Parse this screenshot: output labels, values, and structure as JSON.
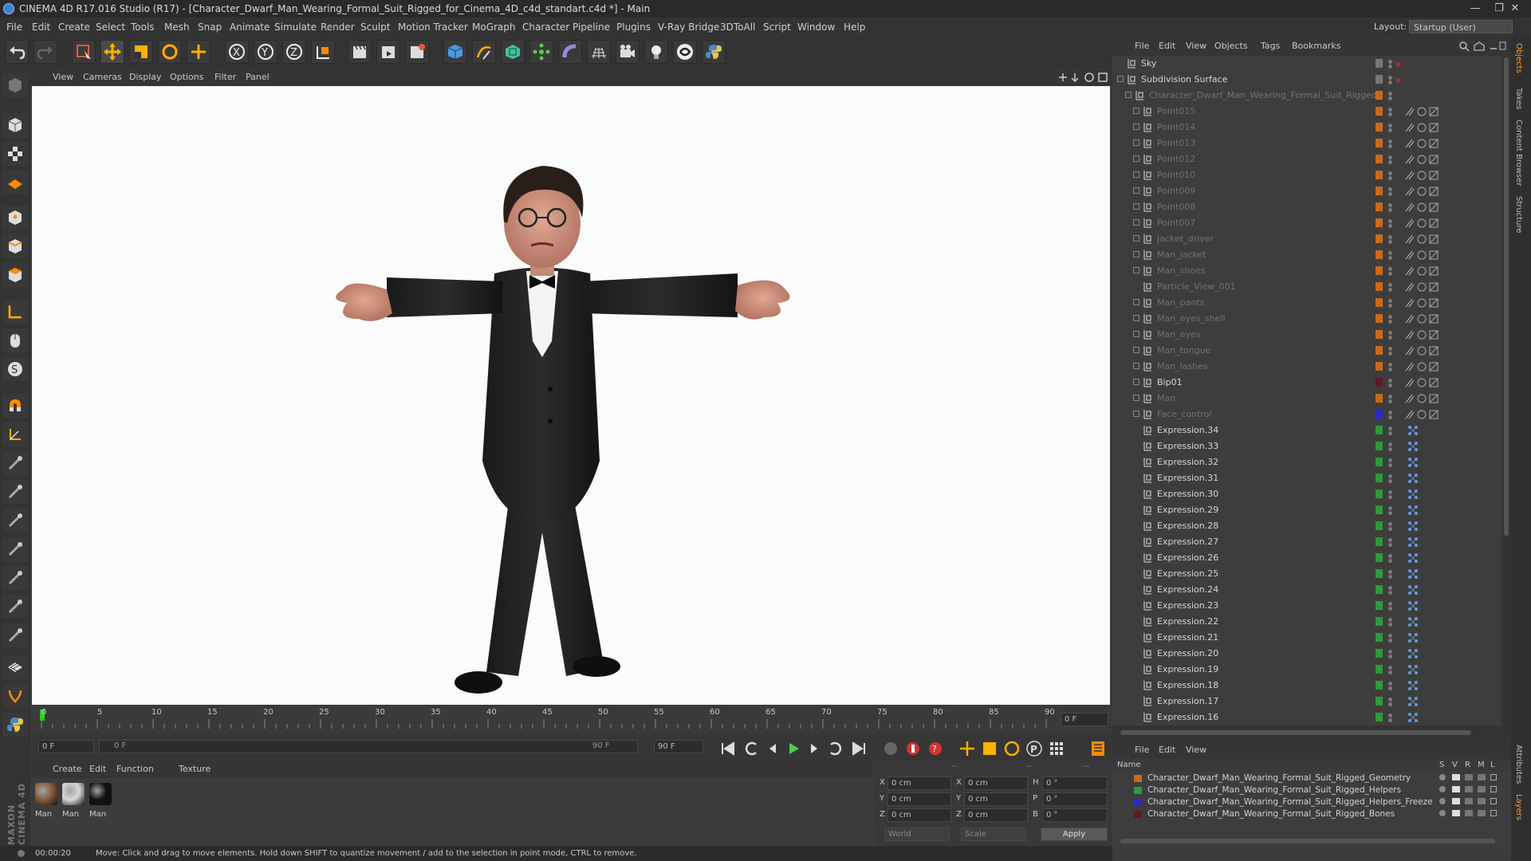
{
  "window": {
    "title": "CINEMA 4D R17.016 Studio (R17) - [Character_Dwarf_Man_Wearing_Formal_Suit_Rigged_for_Cinema_4D_c4d_standart.c4d *] - Main",
    "minimize": "—",
    "restore": "❐",
    "close": "✕"
  },
  "menu": {
    "items": [
      "File",
      "Edit",
      "Create",
      "Select",
      "Tools",
      "Mesh",
      "Snap",
      "Animate",
      "Simulate",
      "Render",
      "Sculpt",
      "Motion Tracker",
      "MoGraph",
      "Character",
      "Pipeline",
      "Plugins",
      "V-Ray Bridge",
      "3DToAll",
      "Script",
      "Window",
      "Help"
    ],
    "layout_label": "Layout:",
    "layout_value": "Startup (User)"
  },
  "viewport": {
    "menu": [
      "View",
      "Cameras",
      "Display",
      "Options",
      "Filter",
      "Panel"
    ]
  },
  "timeline": {
    "ticks": [
      "0",
      "5",
      "10",
      "15",
      "20",
      "25",
      "30",
      "35",
      "40",
      "45",
      "50",
      "55",
      "60",
      "65",
      "70",
      "75",
      "80",
      "85",
      "90"
    ],
    "current_frame": "0 F",
    "start_field": "0 F",
    "range_start": "0 F",
    "range_end": "90 F",
    "end_field": "90 F"
  },
  "materials": {
    "menu": [
      "Create",
      "Edit",
      "Function",
      "Texture"
    ],
    "items": [
      {
        "label": "Man",
        "color": "#8a5a3e"
      },
      {
        "label": "Man",
        "color": "#d8d8d8"
      },
      {
        "label": "Man",
        "color": "#111111"
      }
    ]
  },
  "coords": {
    "header": [
      "--",
      "--",
      "--"
    ],
    "rows": [
      {
        "a": "X",
        "av": "0 cm",
        "b": "X",
        "bv": "0 cm",
        "c": "H",
        "cv": "0 °"
      },
      {
        "a": "Y",
        "av": "0 cm",
        "b": "Y",
        "bv": "0 cm",
        "c": "P",
        "cv": "0 °"
      },
      {
        "a": "Z",
        "av": "0 cm",
        "b": "Z",
        "bv": "0 cm",
        "c": "B",
        "cv": "0 °"
      }
    ],
    "mode1": "World",
    "mode2": "Scale",
    "apply": "Apply"
  },
  "status": {
    "time": "00:00:20",
    "message": "Move: Click and drag to move elements. Hold down SHIFT to quantize movement / add to the selection in point mode, CTRL to remove."
  },
  "objects": {
    "menu": [
      "File",
      "Edit",
      "View",
      "Objects",
      "Tags",
      "Bookmarks"
    ],
    "rows": [
      {
        "name": "Sky",
        "indent": 0,
        "style": "bright",
        "expand": false
      },
      {
        "name": "Subdivision Surface",
        "indent": 0,
        "style": "bright",
        "expand": true
      },
      {
        "name": "Character_Dwarf_Man_Wearing_Formal_Suit_Rigged",
        "indent": 1,
        "style": "dim",
        "expand": true
      },
      {
        "name": "Point015",
        "indent": 2,
        "style": "dim",
        "expand": true
      },
      {
        "name": "Point014",
        "indent": 2,
        "style": "dim",
        "expand": true
      },
      {
        "name": "Point013",
        "indent": 2,
        "style": "dim",
        "expand": true
      },
      {
        "name": "Point012",
        "indent": 2,
        "style": "dim",
        "expand": true
      },
      {
        "name": "Point010",
        "indent": 2,
        "style": "dim",
        "expand": true
      },
      {
        "name": "Point009",
        "indent": 2,
        "style": "dim",
        "expand": true
      },
      {
        "name": "Point008",
        "indent": 2,
        "style": "dim",
        "expand": true
      },
      {
        "name": "Point007",
        "indent": 2,
        "style": "dim",
        "expand": true
      },
      {
        "name": "Jacket_driver",
        "indent": 2,
        "style": "dim",
        "expand": true
      },
      {
        "name": "Man_jacket",
        "indent": 2,
        "style": "dim",
        "expand": true
      },
      {
        "name": "Man_shoes",
        "indent": 2,
        "style": "dim",
        "expand": true
      },
      {
        "name": "Particle_View_001",
        "indent": 2,
        "style": "dim",
        "expand": false
      },
      {
        "name": "Man_pants",
        "indent": 2,
        "style": "dim",
        "expand": true
      },
      {
        "name": "Man_eyes_shell",
        "indent": 2,
        "style": "dim",
        "expand": true
      },
      {
        "name": "Man_eyes",
        "indent": 2,
        "style": "dim",
        "expand": true
      },
      {
        "name": "Man_tongue",
        "indent": 2,
        "style": "dim",
        "expand": true
      },
      {
        "name": "Man_lashes",
        "indent": 2,
        "style": "dim",
        "expand": true
      },
      {
        "name": "Bip01",
        "indent": 2,
        "style": "bright",
        "expand": true
      },
      {
        "name": "Man",
        "indent": 2,
        "style": "dim",
        "expand": true
      },
      {
        "name": "Face_control",
        "indent": 2,
        "style": "dim",
        "expand": true
      },
      {
        "name": "Expression.34",
        "indent": 2,
        "style": "bright",
        "expand": false
      },
      {
        "name": "Expression.33",
        "indent": 2,
        "style": "bright",
        "expand": false
      },
      {
        "name": "Expression.32",
        "indent": 2,
        "style": "bright",
        "expand": false
      },
      {
        "name": "Expression.31",
        "indent": 2,
        "style": "bright",
        "expand": false
      },
      {
        "name": "Expression.30",
        "indent": 2,
        "style": "bright",
        "expand": false
      },
      {
        "name": "Expression.29",
        "indent": 2,
        "style": "bright",
        "expand": false
      },
      {
        "name": "Expression.28",
        "indent": 2,
        "style": "bright",
        "expand": false
      },
      {
        "name": "Expression.27",
        "indent": 2,
        "style": "bright",
        "expand": false
      },
      {
        "name": "Expression.26",
        "indent": 2,
        "style": "bright",
        "expand": false
      },
      {
        "name": "Expression.25",
        "indent": 2,
        "style": "bright",
        "expand": false
      },
      {
        "name": "Expression.24",
        "indent": 2,
        "style": "bright",
        "expand": false
      },
      {
        "name": "Expression.23",
        "indent": 2,
        "style": "bright",
        "expand": false
      },
      {
        "name": "Expression.22",
        "indent": 2,
        "style": "bright",
        "expand": false
      },
      {
        "name": "Expression.21",
        "indent": 2,
        "style": "bright",
        "expand": false
      },
      {
        "name": "Expression.20",
        "indent": 2,
        "style": "bright",
        "expand": false
      },
      {
        "name": "Expression.19",
        "indent": 2,
        "style": "bright",
        "expand": false
      },
      {
        "name": "Expression.18",
        "indent": 2,
        "style": "bright",
        "expand": false
      },
      {
        "name": "Expression.17",
        "indent": 2,
        "style": "bright",
        "expand": false
      },
      {
        "name": "Expression.16",
        "indent": 2,
        "style": "bright",
        "expand": false
      }
    ]
  },
  "layers": {
    "menu": [
      "File",
      "Edit",
      "View"
    ],
    "header": {
      "name": "Name",
      "cols": [
        "S",
        "V",
        "R",
        "M",
        "L"
      ]
    },
    "rows": [
      {
        "name": "Character_Dwarf_Man_Wearing_Formal_Suit_Rigged_Geometry",
        "color": "#c86a1e"
      },
      {
        "name": "Character_Dwarf_Man_Wearing_Formal_Suit_Rigged_Helpers",
        "color": "#2e9a3a"
      },
      {
        "name": "Character_Dwarf_Man_Wearing_Formal_Suit_Rigged_Helpers_Freeze",
        "color": "#2a2ac8"
      },
      {
        "name": "Character_Dwarf_Man_Wearing_Formal_Suit_Rigged_Bones",
        "color": "#5a1a2a"
      }
    ]
  },
  "side_tabs": [
    "Objects",
    "Takes",
    "Content Browser",
    "Structure",
    "Attributes",
    "Layers"
  ],
  "brand": "MAXON CINEMA 4D"
}
